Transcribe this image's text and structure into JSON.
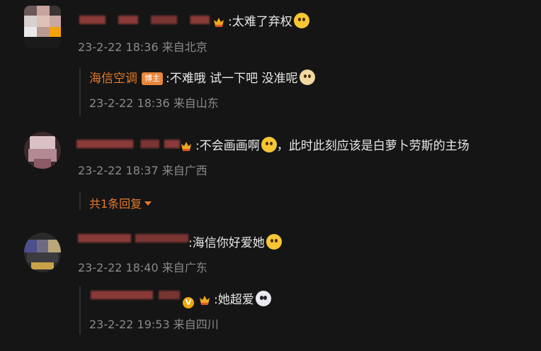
{
  "comments": [
    {
      "text": ":太难了弃权",
      "time": "23-2-22 18:36",
      "location": "来自北京",
      "emoji": "pleading-face-icon",
      "reply": {
        "author": "海信空调",
        "badge": "博主",
        "text": ":不难哦 试一下吧 没准呢",
        "emoji": "doge-icon",
        "time": "23-2-22 18:36",
        "location": "来自山东"
      }
    },
    {
      "text_before": ":不会画画啊",
      "text_after": "，此时此刻应该是白萝卜劳斯的主场",
      "emoji": "tongue-face-icon",
      "time": "23-2-22 18:37",
      "location": "来自广西",
      "replies_toggle": "共1条回复"
    },
    {
      "text": ":海信你好爱她",
      "emoji": "shocked-face-icon",
      "time": "23-2-22 18:40",
      "location": "来自广东",
      "reply": {
        "text": ":她超爱",
        "emoji": "panda-face-icon",
        "time": "23-2-22 19:53",
        "location": "来自四川"
      }
    }
  ],
  "colors": {
    "background": "#151515",
    "accent": "#e57a2b",
    "meta": "#8a8a8a"
  }
}
